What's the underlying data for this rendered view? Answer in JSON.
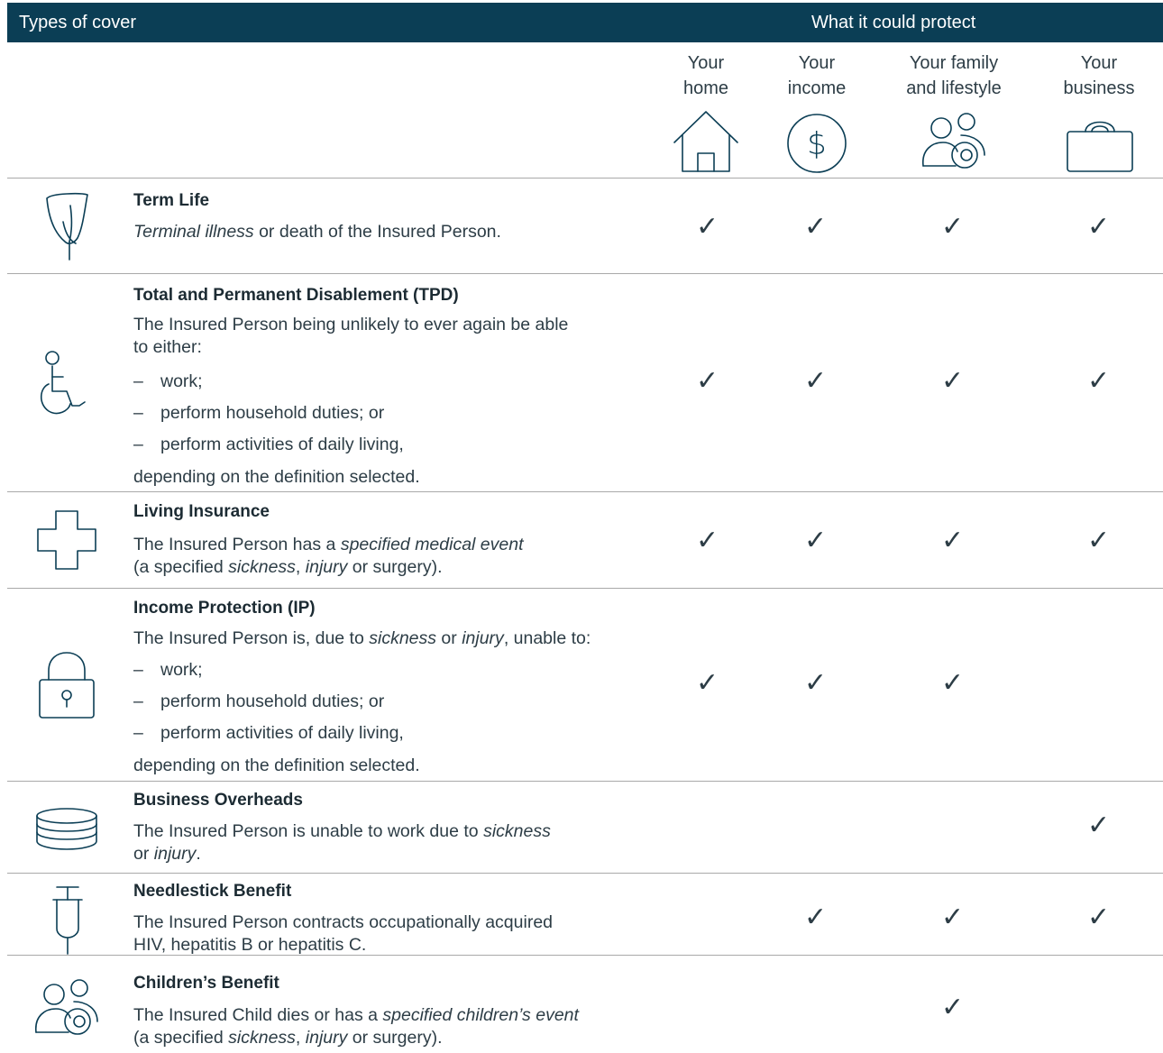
{
  "header": {
    "left": "Types of cover",
    "right": "What it could protect"
  },
  "columns": [
    {
      "line1": "Your",
      "line2": "home",
      "icon": "house-icon"
    },
    {
      "line1": "Your",
      "line2": "income",
      "icon": "dollar-icon"
    },
    {
      "line1": "Your family",
      "line2": "and lifestyle",
      "icon": "family-icon"
    },
    {
      "line1": "Your",
      "line2": "business",
      "icon": "briefcase-icon"
    }
  ],
  "check_mark": "✓",
  "rows": [
    {
      "title": "Term Life",
      "icon": "lily-icon",
      "desc": {
        "a": "Terminal illness",
        "b": " or death of the Insured Person."
      },
      "checks": [
        true,
        true,
        true,
        true
      ]
    },
    {
      "title": "Total and Permanent Disablement (TPD)",
      "icon": "wheelchair-icon",
      "desc": {
        "l1": "The Insured Person being unlikely to ever again be able",
        "l2": "to either:"
      },
      "items": [
        "work;",
        "perform household duties; or",
        "perform activities of daily living,"
      ],
      "dash": "–",
      "footer": "depending on the definition selected.",
      "checks": [
        true,
        true,
        true,
        true
      ]
    },
    {
      "title": "Living Insurance",
      "icon": "medical-cross-icon",
      "desc": {
        "a": "The Insured Person has a ",
        "b": "specified medical event",
        "c": "(a specified ",
        "d": "sickness",
        "e": ", ",
        "f": "injury",
        "g": " or surgery)."
      },
      "checks": [
        true,
        true,
        true,
        true
      ]
    },
    {
      "title": "Income Protection (IP)",
      "icon": "padlock-icon",
      "desc": {
        "a": "The Insured Person is, due to ",
        "b": "sickness",
        "c": " or ",
        "d": "injury",
        "e": ", unable to:"
      },
      "items": [
        "work;",
        "perform household duties; or",
        "perform activities of daily living,"
      ],
      "dash": "–",
      "footer": "depending on the definition selected.",
      "checks": [
        true,
        true,
        true,
        false
      ]
    },
    {
      "title": "Business Overheads",
      "icon": "coin-stack-icon",
      "desc": {
        "a": "The Insured Person is unable to work due to ",
        "b": "sickness",
        "c": "or ",
        "d": "injury",
        "e": "."
      },
      "checks": [
        false,
        false,
        false,
        true
      ]
    },
    {
      "title": "Needlestick Benefit",
      "icon": "syringe-icon",
      "desc": {
        "l1": "The Insured Person contracts occupationally acquired",
        "l2": "HIV, hepatitis B or hepatitis C."
      },
      "checks": [
        false,
        true,
        true,
        true
      ]
    },
    {
      "title": "Children’s Benefit",
      "icon": "family-icon",
      "desc": {
        "a": "The Insured Child dies or has a ",
        "b": "specified children’s event",
        "c": "(a specified ",
        "d": "sickness",
        "e": ", ",
        "f": "injury",
        "g": " or surgery)."
      },
      "checks": [
        false,
        false,
        true,
        false
      ]
    }
  ]
}
